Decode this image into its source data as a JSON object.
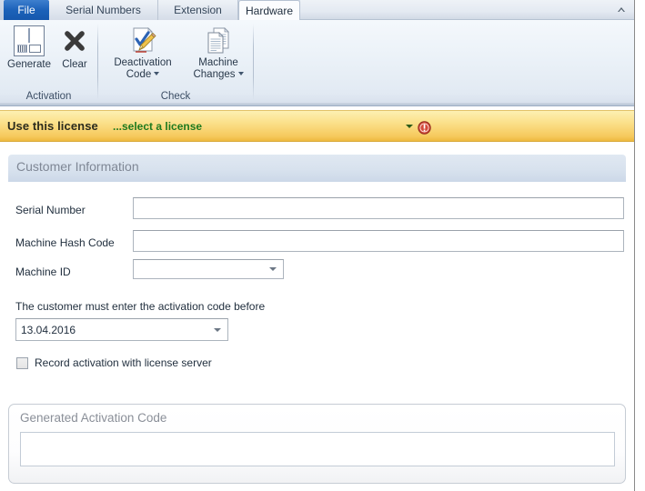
{
  "window": {
    "collapse_icon": "chevron-up-icon"
  },
  "ribbon": {
    "tabs": [
      {
        "label": "File",
        "active": false,
        "kind": "file"
      },
      {
        "label": "Serial Numbers",
        "active": false,
        "kind": "normal"
      },
      {
        "label": "Extension",
        "active": false,
        "kind": "normal"
      },
      {
        "label": "Hardware",
        "active": true,
        "kind": "normal"
      }
    ],
    "groups": [
      {
        "name": "Activation",
        "label": "Activation",
        "buttons": [
          {
            "label": "Generate",
            "icon": "generate-icon",
            "has_dropdown": false
          },
          {
            "label": "Clear",
            "icon": "clear-x-icon",
            "has_dropdown": false
          }
        ]
      },
      {
        "name": "Check",
        "label": "Check",
        "buttons": [
          {
            "label_line1": "Deactivation",
            "label_line2": "Code",
            "icon": "document-check-pencil-icon",
            "has_dropdown": true
          },
          {
            "label_line1": "Machine",
            "label_line2": "Changes",
            "icon": "stacked-documents-icon",
            "has_dropdown": true
          }
        ]
      }
    ]
  },
  "license_bar": {
    "title": "Use this license",
    "value": "...select a license",
    "value_color": "#1f7a1f",
    "background_color": "#f6c95c",
    "dropdown_icon": "chevron-down-icon",
    "error_icon": "error-exclamation-icon"
  },
  "customer_information": {
    "panel_title": "Customer Information",
    "fields": [
      {
        "label": "Serial Number",
        "value": "",
        "type": "text"
      },
      {
        "label": "Machine Hash Code",
        "value": "",
        "type": "text"
      },
      {
        "label": "Machine ID",
        "value": "",
        "type": "combobox"
      }
    ],
    "note": "The customer must enter the activation code before",
    "date": {
      "value": "13.04.2016",
      "type": "datepicker"
    },
    "checkbox": {
      "label": "Record activation with license server",
      "checked": false
    }
  },
  "generated_activation_code": {
    "title": "Generated Activation Code",
    "value": ""
  }
}
